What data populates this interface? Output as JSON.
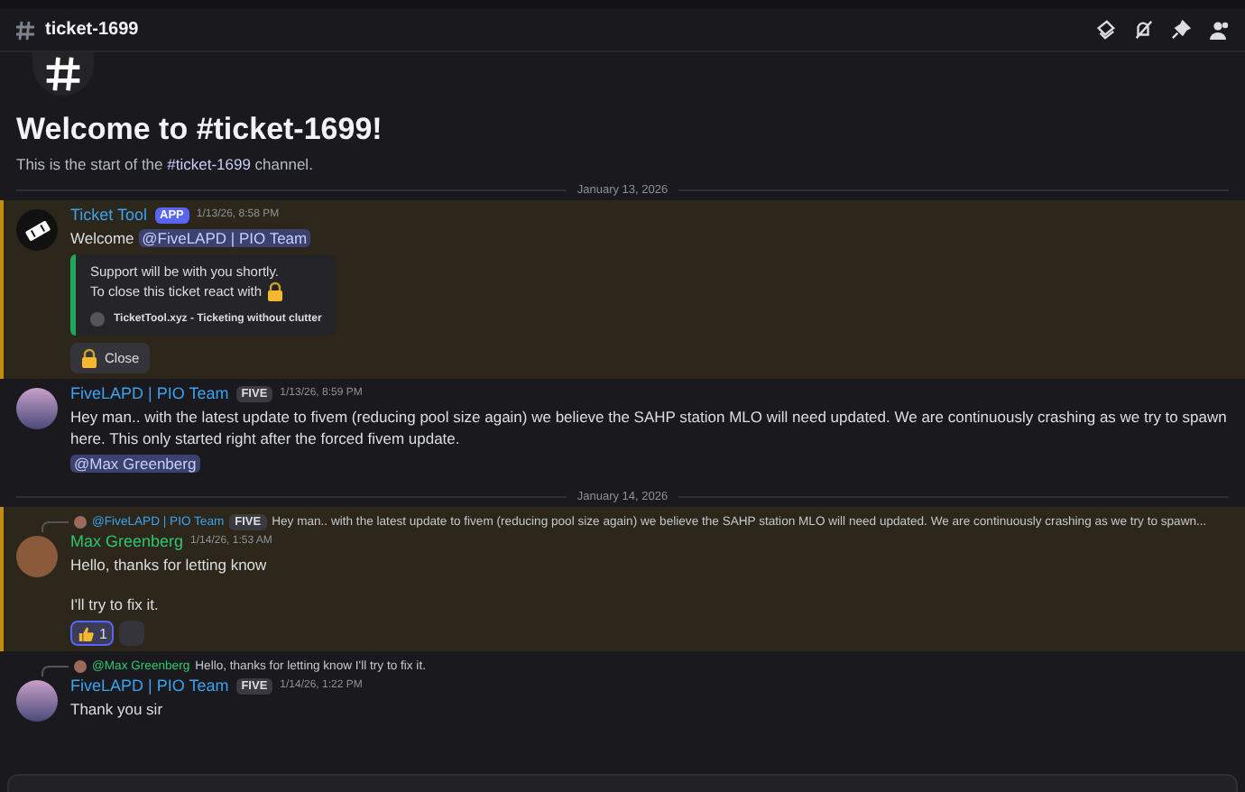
{
  "header": {
    "channel": "ticket-1699"
  },
  "welcome": {
    "title": "Welcome to #ticket-1699!",
    "subtitle_start": "This is the start of the ",
    "channel_link": "#ticket-1699",
    "subtitle_end": " channel."
  },
  "messages": [
    {
      "kind": "divider",
      "text": "January 13, 2026"
    },
    {
      "kind": "message",
      "highlighted": true,
      "avatar": {
        "kind": "ticket"
      },
      "author": "Ticket Tool",
      "color": "#3ba3f0",
      "tag": "APP",
      "timestamp": "1/13/26, 8:58 PM",
      "text": "Welcome ",
      "mention": "@FiveLAPD | PIO Team",
      "embed": {
        "line1": "Support will be with you shortly.",
        "line2": "To close this ticket react with",
        "footer": "TicketTool.xyz - Ticketing without clutter"
      },
      "button": "Close"
    },
    {
      "kind": "message",
      "highlighted": false,
      "avatar": {
        "kind": "lapd"
      },
      "author": "FiveLAPD | PIO Team",
      "color": "#3ba3f0",
      "tag": "FIVE",
      "timestamp": "1/13/26, 8:59 PM",
      "text": "Hey man.. with the latest update to fivem (reducing pool size again) we believe the SAHP station MLO will need updated.  We are continuously crashing as we try to spawn here. This only started right after the forced fivem update.",
      "mention_line": "@Max Greenberg"
    },
    {
      "kind": "divider",
      "text": "January 14, 2026"
    },
    {
      "kind": "message",
      "highlighted": true,
      "avatar": {
        "kind": "person"
      },
      "author": "Max Greenberg",
      "color": "#2dc770",
      "timestamp": "1/14/26, 1:53 AM",
      "reply": {
        "author": "@FiveLAPD | PIO Team",
        "color": "#3ba3f0",
        "tag": "FIVE",
        "text": "Hey man.. with the latest update to fivem (reducing pool size again) we believe the SAHP station MLO will need updated.  We are continuously crashing as we try to spawn..."
      },
      "lines": [
        "Hello, thanks for letting know",
        "I'll try to fix it."
      ],
      "reaction": {
        "count": "1",
        "selected": true
      }
    },
    {
      "kind": "message",
      "highlighted": false,
      "avatar": {
        "kind": "lapd"
      },
      "author": "FiveLAPD | PIO Team",
      "color": "#3ba3f0",
      "tag": "FIVE",
      "timestamp": "1/14/26, 1:22 PM",
      "reply": {
        "author": "@Max Greenberg",
        "color": "#2dc770",
        "text": "Hello, thanks for letting know  I'll try to fix it."
      },
      "text": "Thank you sir"
    }
  ]
}
